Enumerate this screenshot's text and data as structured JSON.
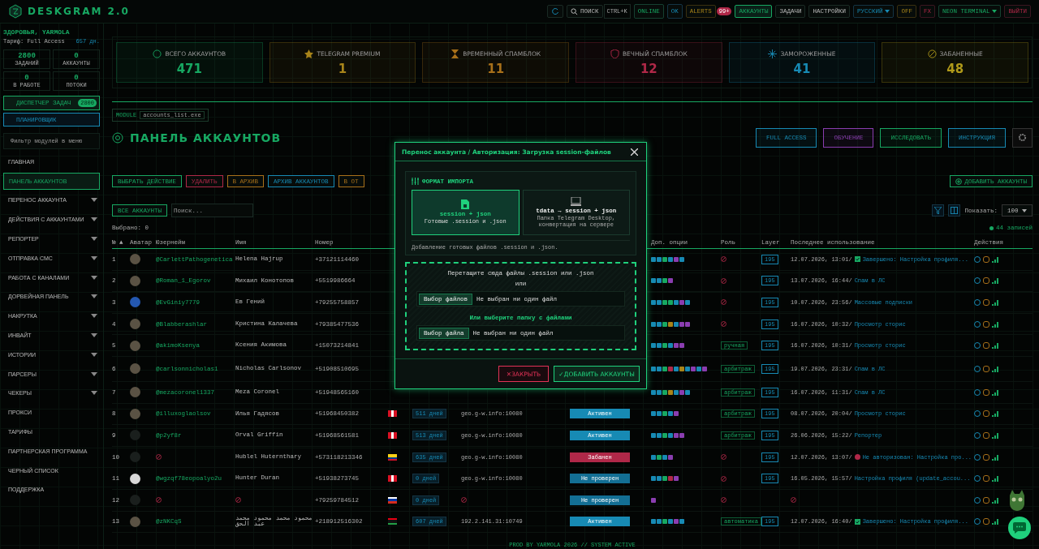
{
  "app": {
    "logo": "DESKGRAM 2.0"
  },
  "topbar": {
    "search": "ПОИСК",
    "shortcut": "CTRL+K",
    "online": "ONLINE",
    "ok": "OK",
    "alerts": "ALERTS",
    "alerts_badge": "99+",
    "nav": [
      {
        "label": "АККАУНТЫ",
        "selected": true
      },
      {
        "label": "ЗАДАЧИ",
        "selected": false
      },
      {
        "label": "НАСТРОЙКИ",
        "selected": false
      }
    ],
    "language": "РУССКИЙ",
    "off": "OFF",
    "fx": "FX",
    "theme": "NEON TERMINAL",
    "logout": "ВЫЙТИ"
  },
  "sidebar": {
    "greeting": "ЗДОРОВЬЯ, YARMOLA",
    "plan": "Тариф: Full Access",
    "days": "657 дн.",
    "stats": [
      {
        "value": "2800",
        "label": "ЗАДАНИЙ"
      },
      {
        "value": "0",
        "label": "АККАУНТЫ"
      },
      {
        "value": "0",
        "label": "В РАБОТЕ"
      },
      {
        "value": "0",
        "label": "ПОТОКИ"
      }
    ],
    "dispatcher": "ДИСПЕТЧЕР ЗАДАЧ",
    "dispatcher_badge": "2800",
    "scheduler": "ПЛАНИРОВЩИК",
    "filter_placeholder": "Фильтр модулей в меню",
    "items": [
      {
        "label": "ГЛАВНАЯ",
        "selected": false,
        "expandable": false
      },
      {
        "label": "ПАНЕЛЬ АККАУНТОВ",
        "selected": true,
        "expandable": false
      },
      {
        "label": "ПЕРЕНОС АККАУНТА",
        "selected": false,
        "expandable": true
      },
      {
        "label": "ДЕЙСТВИЯ С АККАУНТАМИ",
        "selected": false,
        "expandable": true
      },
      {
        "label": "РЕПОРТЕР",
        "selected": false,
        "expandable": true
      },
      {
        "label": "ОТПРАВКА СМС",
        "selected": false,
        "expandable": true
      },
      {
        "label": "РАБОТА С КАНАЛАМИ",
        "selected": false,
        "expandable": true
      },
      {
        "label": "ДОРВЕЙНАЯ ПАНЕЛЬ",
        "selected": false,
        "expandable": true
      },
      {
        "label": "НАКРУТКА",
        "selected": false,
        "expandable": true
      },
      {
        "label": "ИНВАЙТ",
        "selected": false,
        "expandable": true
      },
      {
        "label": "ИСТОРИИ",
        "selected": false,
        "expandable": true
      },
      {
        "label": "ПАРСЕРЫ",
        "selected": false,
        "expandable": true
      },
      {
        "label": "ЧЕКЕРЫ",
        "selected": false,
        "expandable": true
      },
      {
        "label": "ПРОКСИ",
        "selected": false,
        "expandable": false
      },
      {
        "label": "ТАРИФЫ",
        "selected": false,
        "expandable": false
      },
      {
        "label": "ПАРТНЕРСКАЯ ПРОГРАММА",
        "selected": false,
        "expandable": false
      },
      {
        "label": "ЧЕРНЫЙ СПИСОК",
        "selected": false,
        "expandable": false
      },
      {
        "label": "ПОДДЕРЖКА",
        "selected": false,
        "expandable": false
      }
    ]
  },
  "stats": [
    {
      "label": "ВСЕГО АККАУНТОВ",
      "value": "471",
      "color": "#17a862",
      "kind": "users"
    },
    {
      "label": "TELEGRAM PREMIUM",
      "value": "1",
      "color": "#a8841a",
      "kind": "star"
    },
    {
      "label": "ВРЕМЕННЫЙ СПАМБЛОК",
      "value": "11",
      "color": "#a8701a",
      "kind": "hourglass"
    },
    {
      "label": "ВЕЧНЫЙ СПАМБЛОК",
      "value": "12",
      "color": "#b02848",
      "kind": "shield"
    },
    {
      "label": "ЗАМОРОЖЕННЫЕ",
      "value": "41",
      "color": "#178ab4",
      "kind": "snow"
    },
    {
      "label": "ЗАБАНЕННЫЕ",
      "value": "48",
      "color": "#b09a1a",
      "kind": "ban"
    }
  ],
  "panel": {
    "module_tag": "MODULE",
    "module_file": "accounts_list.exe",
    "title": "ПАНЕЛЬ АККАУНТОВ",
    "header_buttons": [
      {
        "label": "FULL ACCESS",
        "color": "#178ab4"
      },
      {
        "label": "ОБУЧЕНИЕ",
        "color": "#8a3db0"
      },
      {
        "label": "ИССЛЕДОВАТЬ",
        "color": "#17a862"
      },
      {
        "label": "ИНСТРУКЦИЯ",
        "color": "#178ab4"
      }
    ],
    "actions": [
      {
        "label": "ВЫБРАТЬ ДЕЙСТВИЕ",
        "color": "#17a862"
      },
      {
        "label": "УДАЛИТЬ",
        "color": "#b02848"
      },
      {
        "label": "В АРХИВ",
        "color": "#a8701a"
      },
      {
        "label": "АРХИВ АККАУНТОВ",
        "color": "#178ab4"
      },
      {
        "label": "В ОТ",
        "color": "#a8701a"
      }
    ],
    "add_button": "ДОБАВИТЬ АККАУНТЫ",
    "all_button": "ВСЕ АККАУНТЫ",
    "search_placeholder": "Поиск...",
    "show_label": "Показать:",
    "show_value": "100",
    "selected_count": "Выбрано: 0",
    "records": "44 записей"
  },
  "table": {
    "columns": [
      {
        "label": "№ ▲"
      },
      {
        "label": "Аватар"
      },
      {
        "label": "Юзернейм"
      },
      {
        "label": "Имя"
      },
      {
        "label": "Номер"
      },
      {
        "label": "Доп. опции"
      },
      {
        "label": "Роль"
      },
      {
        "label": "Layer"
      },
      {
        "label": "Последнее использование"
      },
      {
        "label": "Действия"
      }
    ],
    "rows": [
      {
        "num": "1",
        "avatar": {
          "kind": "photo"
        },
        "username": "@CarlettPathogenetica",
        "name": "Helena Hajrup",
        "phone": "+37121114460",
        "options": [
          {
            "color": "#178ab4"
          },
          {
            "color": "#178ab4"
          },
          {
            "color": "#17a862"
          },
          {
            "color": "#178ab4"
          },
          {
            "color": "#8a3db0"
          },
          {
            "color": "#178ab4"
          }
        ],
        "layer": "195",
        "last": {
          "time": "12.07.2026, 13:01/",
          "kind": "done",
          "text": "Завершено: Настройка профиля..."
        }
      },
      {
        "num": "2",
        "avatar": {
          "kind": "photo"
        },
        "username": "@Roman_1_Egorov",
        "name": "Михаил Конотопов",
        "phone": "+5519986664",
        "options": [
          {
            "color": "#178ab4"
          },
          {
            "color": "#178ab4"
          },
          {
            "color": "#17a862"
          },
          {
            "color": "#8a3db0"
          }
        ],
        "layer": "195",
        "last": {
          "time": "13.07.2026, 16:44/",
          "text": "Спам в ЛС"
        }
      },
      {
        "num": "3",
        "avatar": {
          "kind": "blue"
        },
        "username": "@EvGiniy7779",
        "name": "Ев Гений",
        "phone": "+79255758857",
        "options": [
          {
            "color": "#178ab4"
          },
          {
            "color": "#178ab4"
          },
          {
            "color": "#17a862"
          },
          {
            "color": "#17a862"
          },
          {
            "color": "#178ab4"
          },
          {
            "color": "#8a3db0"
          },
          {
            "color": "#178ab4"
          }
        ],
        "layer": "195",
        "last": {
          "time": "10.07.2026, 23:56/",
          "text": "Массовые подписки"
        }
      },
      {
        "num": "4",
        "avatar": {
          "kind": "photo"
        },
        "username": "@Blabberashlar",
        "name": "Кристина Калачева",
        "phone": "+79385477536",
        "options": [
          {
            "color": "#178ab4"
          },
          {
            "color": "#178ab4"
          },
          {
            "color": "#17a862"
          },
          {
            "color": "#a8841a"
          },
          {
            "color": "#178ab4"
          },
          {
            "color": "#8a3db0"
          },
          {
            "color": "#8a3db0"
          }
        ],
        "layer": "195",
        "last": {
          "time": "16.07.2026, 10:32/",
          "text": "Просмотр сторис"
        }
      },
      {
        "num": "5",
        "avatar": {
          "kind": "photo"
        },
        "username": "@akimoKsenya",
        "name": "Ксения Акимова",
        "phone": "+15073214841",
        "options": [
          {
            "color": "#178ab4"
          },
          {
            "color": "#178ab4"
          },
          {
            "color": "#17a862"
          },
          {
            "color": "#178ab4"
          },
          {
            "color": "#8a3db0"
          },
          {
            "color": "#8a3db0"
          }
        ],
        "role": "ручная",
        "layer": "195",
        "last": {
          "time": "16.07.2026, 10:31/",
          "text": "Просмотр сторис"
        }
      },
      {
        "num": "6",
        "avatar": {
          "kind": "photo"
        },
        "username": "@carlsonnicholas1",
        "name": "Nicholas Carlsonov",
        "phone": "+51908510695",
        "options": [
          {
            "color": "#178ab4"
          },
          {
            "color": "#178ab4"
          },
          {
            "color": "#17a862"
          },
          {
            "color": "#b02848"
          },
          {
            "color": "#178ab4"
          },
          {
            "color": "#a8841a"
          },
          {
            "color": "#178ab4"
          },
          {
            "color": "#8a3db0"
          },
          {
            "color": "#178ab4"
          },
          {
            "color": "#8a3db0"
          }
        ],
        "role": "арбитраж",
        "layer": "195",
        "last": {
          "time": "19.07.2026, 23:31/",
          "text": "Спам в ЛС"
        }
      },
      {
        "num": "7",
        "avatar": {
          "kind": "photo"
        },
        "username": "@mezacoronel1337",
        "name": "Meza Coronel",
        "phone": "+51948565160",
        "options": [
          {
            "color": "#178ab4"
          },
          {
            "color": "#178ab4"
          },
          {
            "color": "#17a862"
          },
          {
            "color": "#a8841a"
          },
          {
            "color": "#178ab4"
          },
          {
            "color": "#8a3db0"
          },
          {
            "color": "#178ab4"
          }
        ],
        "role": "арбитраж",
        "layer": "195",
        "last": {
          "time": "16.07.2026, 11:31/",
          "text": "Спам в ЛС"
        }
      },
      {
        "num": "8",
        "avatar": {
          "kind": "photo"
        },
        "username": "@illuxoglaolsov",
        "name": "Илья Гадясов",
        "phone": "+51968450382",
        "flag": {
          "kind": "pe"
        },
        "days": "511 дней",
        "proxy": "geo.g-w.info:10080",
        "status": {
          "label": "Активен",
          "kind": "active"
        },
        "options": [
          {
            "color": "#178ab4"
          },
          {
            "color": "#178ab4"
          },
          {
            "color": "#17a862"
          },
          {
            "color": "#178ab4"
          },
          {
            "color": "#8a3db0"
          }
        ],
        "role": "арбитраж",
        "layer": "195",
        "last": {
          "time": "08.07.2026, 20:04/",
          "text": "Просмотр сторис"
        }
      },
      {
        "num": "9",
        "avatar": {
          "kind": "dark"
        },
        "username": "@p2yf8r",
        "name": "Orval Griffin",
        "phone": "+51968561581",
        "flag": {
          "kind": "pe"
        },
        "days": "513 дней",
        "proxy": "geo.g-w.info:10080",
        "status": {
          "label": "Активен",
          "kind": "active"
        },
        "options": [
          {
            "color": "#178ab4"
          },
          {
            "color": "#178ab4"
          },
          {
            "color": "#17a862"
          },
          {
            "color": "#178ab4"
          },
          {
            "color": "#8a3db0"
          },
          {
            "color": "#8a3db0"
          }
        ],
        "role": "арбитраж",
        "layer": "195",
        "last": {
          "time": "26.06.2026, 15:22/",
          "text": "Репортер"
        }
      },
      {
        "num": "10",
        "avatar": {
          "kind": "dark"
        },
        "name": "Hublel Huternthary",
        "phone": "+573118213346",
        "flag": {
          "kind": "co"
        },
        "days": "635 дней",
        "proxy": "geo.g-w.info:10080",
        "status": {
          "label": "Забанен",
          "kind": "banned"
        },
        "options": [
          {
            "color": "#178ab4"
          },
          {
            "color": "#17a862"
          },
          {
            "color": "#178ab4"
          },
          {
            "color": "#8a3db0"
          }
        ],
        "layer": "195",
        "last": {
          "time": "12.07.2026, 13:07/",
          "kind": "error",
          "text": "Не авторизован: Настройка про..."
        }
      },
      {
        "num": "11",
        "avatar": {
          "kind": "telegram"
        },
        "username": "@wgzqf78eopoalyo2u",
        "name": "Hunter Duran",
        "phone": "+51938273745",
        "flag": {
          "kind": "pe"
        },
        "days": "0 дней",
        "proxy": "geo.g-w.info:10080",
        "status": {
          "label": "Не проверен",
          "kind": "unchecked"
        },
        "options": [
          {
            "color": "#178ab4"
          },
          {
            "color": "#178ab4"
          },
          {
            "color": "#17a862"
          },
          {
            "color": "#b02848"
          },
          {
            "color": "#8a3db0"
          }
        ],
        "layer": "195",
        "last": {
          "time": "16.05.2026, 15:57/",
          "text": "Настройка профиля (update_accou..."
        }
      },
      {
        "num": "12",
        "avatar": {
          "kind": "dark"
        },
        "phone": "+79259784512",
        "flag": {
          "kind": "ru"
        },
        "days": "0 дней",
        "status": {
          "label": "Не проверен",
          "kind": "unchecked"
        },
        "options": [
          {
            "color": "#8a3db0"
          }
        ]
      },
      {
        "num": "13",
        "avatar": {
          "kind": "photo"
        },
        "username": "@zNKCqS",
        "name": "محمود محمد محمود محمد عبد الحق",
        "phone": "+218912516302",
        "flag": {
          "kind": "ly"
        },
        "days": "607 дней",
        "proxy": "192.2.141.31:10749",
        "status": {
          "label": "Активен",
          "kind": "active"
        },
        "options": [
          {
            "color": "#178ab4"
          },
          {
            "color": "#178ab4"
          },
          {
            "color": "#17a862"
          },
          {
            "color": "#178ab4"
          },
          {
            "color": "#8a3db0"
          },
          {
            "color": "#178ab4"
          }
        ],
        "role": "автоматика",
        "layer": "195",
        "last": {
          "time": "12.07.2026, 16:40/",
          "kind": "done",
          "text": "Завершено: Настройка профиля..."
        }
      }
    ]
  },
  "footer": "PROD BY YARMOLA 2026 // SYSTEM ACTIVE",
  "modal": {
    "title": "Перенос аккаунта / Авторизация: Загрузка session-файлов",
    "section": "ФОРМАТ ИМПОРТА",
    "formats": [
      {
        "title": "session + json",
        "desc": "Готовые .session и .json",
        "selected": true
      },
      {
        "title": "tdata → session + json",
        "desc": "Папка Telegram Desktop, конвертация на сервере",
        "selected": false
      }
    ],
    "hint": "Добавление готовых файлов .session и .json.",
    "drop_text": "Перетащите сюда файлы .session или .json",
    "or": "или",
    "files_button": "Выбор файлов",
    "files_value": "Не выбран ни один файл",
    "folder_label": "Или выберите папку с файлами",
    "folder_button": "Выбор файла",
    "folder_value": "Не выбран ни один файл",
    "close_button": "✕ЗАКРЫТЬ",
    "submit_button": "✓ДОБАВИТЬ АККАУНТЫ"
  }
}
